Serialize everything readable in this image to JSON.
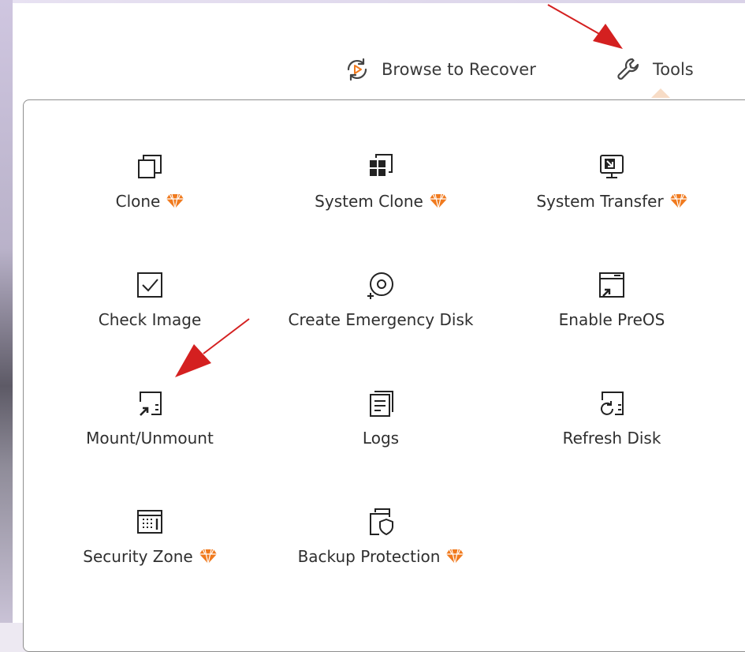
{
  "header": {
    "browse_label": "Browse to Recover",
    "tools_label": "Tools"
  },
  "tools": [
    {
      "label": "Clone",
      "icon": "clone-icon",
      "premium": true
    },
    {
      "label": "System Clone",
      "icon": "system-clone-icon",
      "premium": true
    },
    {
      "label": "System Transfer",
      "icon": "system-transfer-icon",
      "premium": true
    },
    {
      "label": "Check Image",
      "icon": "check-image-icon",
      "premium": false
    },
    {
      "label": "Create Emergency Disk",
      "icon": "emergency-disk-icon",
      "premium": false
    },
    {
      "label": "Enable PreOS",
      "icon": "preos-icon",
      "premium": false
    },
    {
      "label": "Mount/Unmount",
      "icon": "mount-icon",
      "premium": false
    },
    {
      "label": "Logs",
      "icon": "logs-icon",
      "premium": false
    },
    {
      "label": "Refresh Disk",
      "icon": "refresh-disk-icon",
      "premium": false
    },
    {
      "label": "Security Zone",
      "icon": "security-zone-icon",
      "premium": true
    },
    {
      "label": "Backup Protection",
      "icon": "backup-protection-icon",
      "premium": true
    }
  ],
  "colors": {
    "premium_gem": "#f07a1e",
    "annotation_arrow": "#d42020",
    "text": "#2f2f2f",
    "browse_icon_accent": "#f07a1e"
  }
}
